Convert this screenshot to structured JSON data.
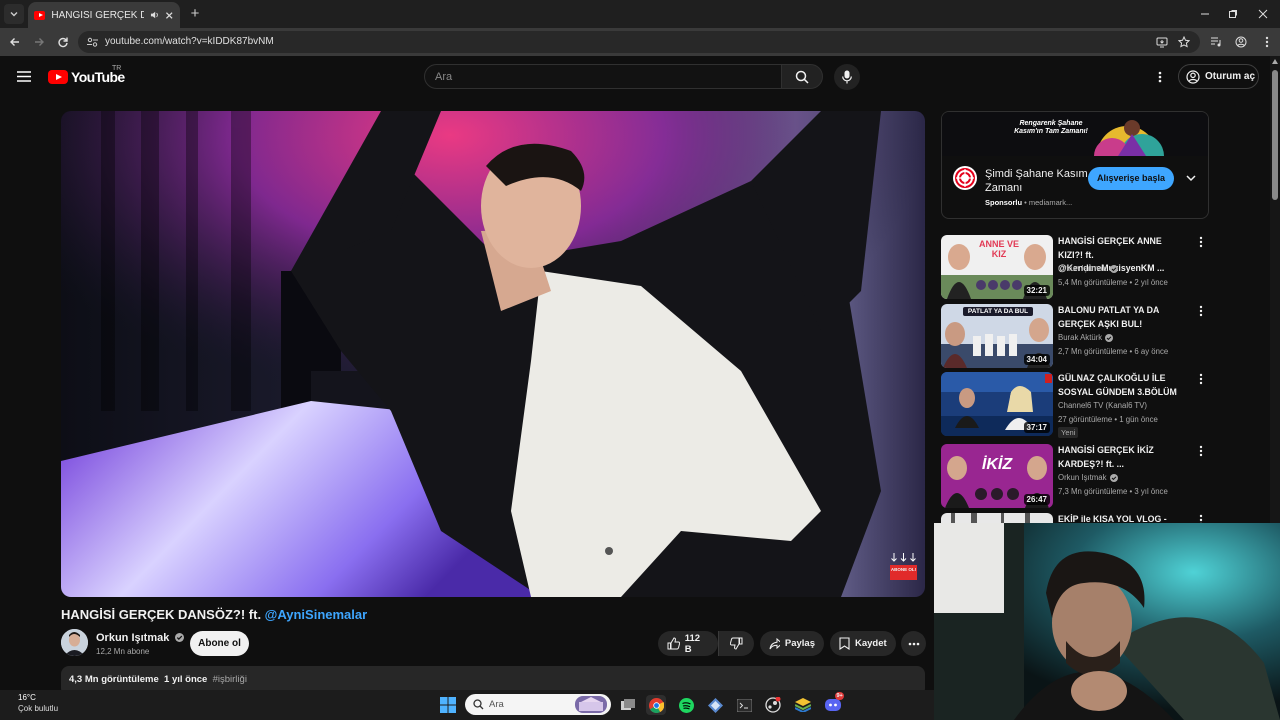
{
  "browser": {
    "tab_title": "HANGİSİ GERÇEK DANSÖZ?! ft.",
    "url": "youtube.com/watch?v=kIDDK87bvNM"
  },
  "header": {
    "logo_text": "YouTube",
    "country": "TR",
    "search_placeholder": "Ara",
    "signin_label": "Oturum aç"
  },
  "video": {
    "title": "HANGİSİ GERÇEK DANSÖZ?! ft. ",
    "title_mention": "@AyniSinemalar",
    "overlay_text": "ABONE OL!",
    "channel_name": "Orkun Işıtmak",
    "subscribers": "12,2 Mn abone",
    "subscribe_label": "Abone ol",
    "likes": "112 B",
    "share_label": "Paylaş",
    "save_label": "Kaydet",
    "views": "4,3 Mn görüntüleme",
    "published": "1 yıl önce",
    "hashtag": "#işbirliği"
  },
  "ad": {
    "banner_text": "Rengarenk Şahane Kasım'ın Tam Zamanı!",
    "headline": "Şimdi Şahane Kasım Zamanı",
    "sponsored": "Sponsorlu",
    "advertiser": "mediamark...",
    "cta": "Alışverişe başla"
  },
  "recommendations": [
    {
      "title": "HANGİSİ GERÇEK ANNE KIZI?! ft. @KendineMuzisyenKM ...",
      "channel": "Orkun Işıtmak",
      "verified": true,
      "meta": "5,4 Mn görüntüleme • 2 yıl önce",
      "duration": "32:21",
      "thumb_text": "ANNE VE KIZ",
      "accent": "#e23a55"
    },
    {
      "title": "BALONU PATLAT YA DA GERÇEK AŞKI BUL!",
      "channel": "Burak Aktürk",
      "verified": true,
      "meta": "2,7 Mn görüntüleme • 6 ay önce",
      "duration": "34:04",
      "thumb_text": "PATLAT YA DA BUL",
      "accent": "#2d4f8a"
    },
    {
      "title": "GÜLNAZ ÇALIKOĞLU İLE SOSYAL GÜNDEM 3.BÖLÜM",
      "channel": "Channel6 TV (Kanal6 TV)",
      "verified": false,
      "meta": "27 görüntüleme • 1 gün önce",
      "duration": "37:17",
      "badge": "Yeni",
      "thumb_text": "",
      "accent": "#1b3d7a"
    },
    {
      "title": "HANGİSİ GERÇEK İKİZ KARDEŞ?! ft. ...",
      "channel": "Orkun Işıtmak",
      "verified": true,
      "meta": "7,3 Mn görüntüleme • 3 yıl önce",
      "duration": "26:47",
      "thumb_text": "İKİZ",
      "accent": "#b6279b"
    },
    {
      "title": "EKİP ile KISA YOL VLOG -",
      "channel": "",
      "verified": false,
      "meta": "",
      "duration": "",
      "thumb_text": "",
      "accent": "#e8e8e8"
    }
  ],
  "taskbar": {
    "temperature": "16°C",
    "weather": "Çok bulutlu",
    "search_placeholder": "Ara",
    "discord_badge": "9+"
  }
}
